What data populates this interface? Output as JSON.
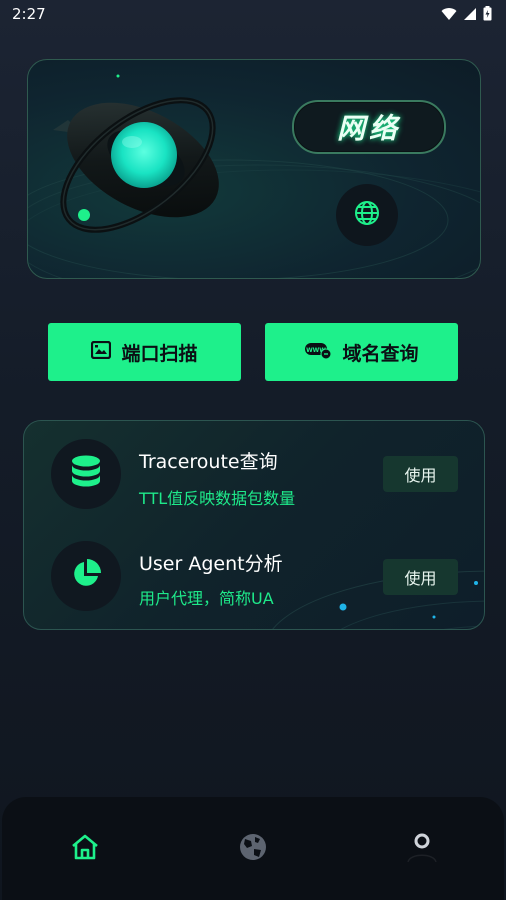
{
  "status_bar": {
    "time": "2:27"
  },
  "hero": {
    "title": "网络"
  },
  "actions": [
    {
      "label": "端口扫描",
      "icon": "image-icon"
    },
    {
      "label": "域名查询",
      "icon": "www-icon"
    }
  ],
  "tools": [
    {
      "title": "Traceroute查询",
      "subtitle": "TTL值反映数据包数量",
      "button": "使用",
      "icon": "database-icon"
    },
    {
      "title": "User Agent分析",
      "subtitle": "用户代理，简称UA",
      "button": "使用",
      "icon": "pie-chart-icon"
    }
  ],
  "bottom_nav": [
    {
      "name": "home",
      "icon": "home-icon",
      "active": true
    },
    {
      "name": "globe",
      "icon": "globe-icon",
      "active": false
    },
    {
      "name": "profile",
      "icon": "profile-icon",
      "active": false
    }
  ],
  "colors": {
    "accent": "#1ef08b",
    "background": "#141c28"
  }
}
